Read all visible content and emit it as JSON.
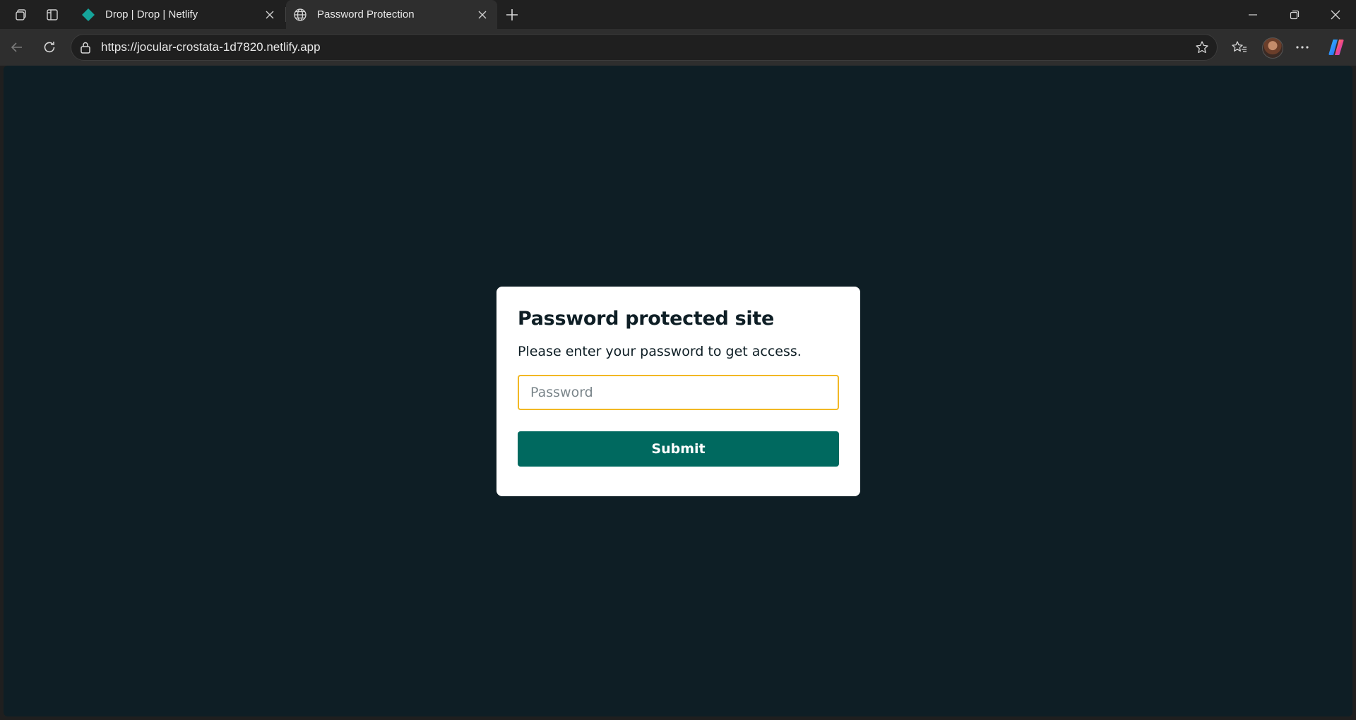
{
  "browser": {
    "tabs": [
      {
        "title": "Drop | Drop | Netlify",
        "favicon": "netlify-diamond-icon",
        "active": false
      },
      {
        "title": "Password Protection",
        "favicon": "globe-icon",
        "active": true
      }
    ],
    "address": {
      "url": "https://jocular-crostata-1d7820.netlify.app"
    }
  },
  "page": {
    "heading": "Password protected site",
    "description": "Please enter your password to get access.",
    "password_placeholder": "Password",
    "password_value": "",
    "submit_label": "Submit"
  },
  "colors": {
    "page_background": "#0e1e25",
    "submit_button": "#00695f",
    "input_focus_border": "#f2b824",
    "netlify_brand": "#15a49a"
  }
}
